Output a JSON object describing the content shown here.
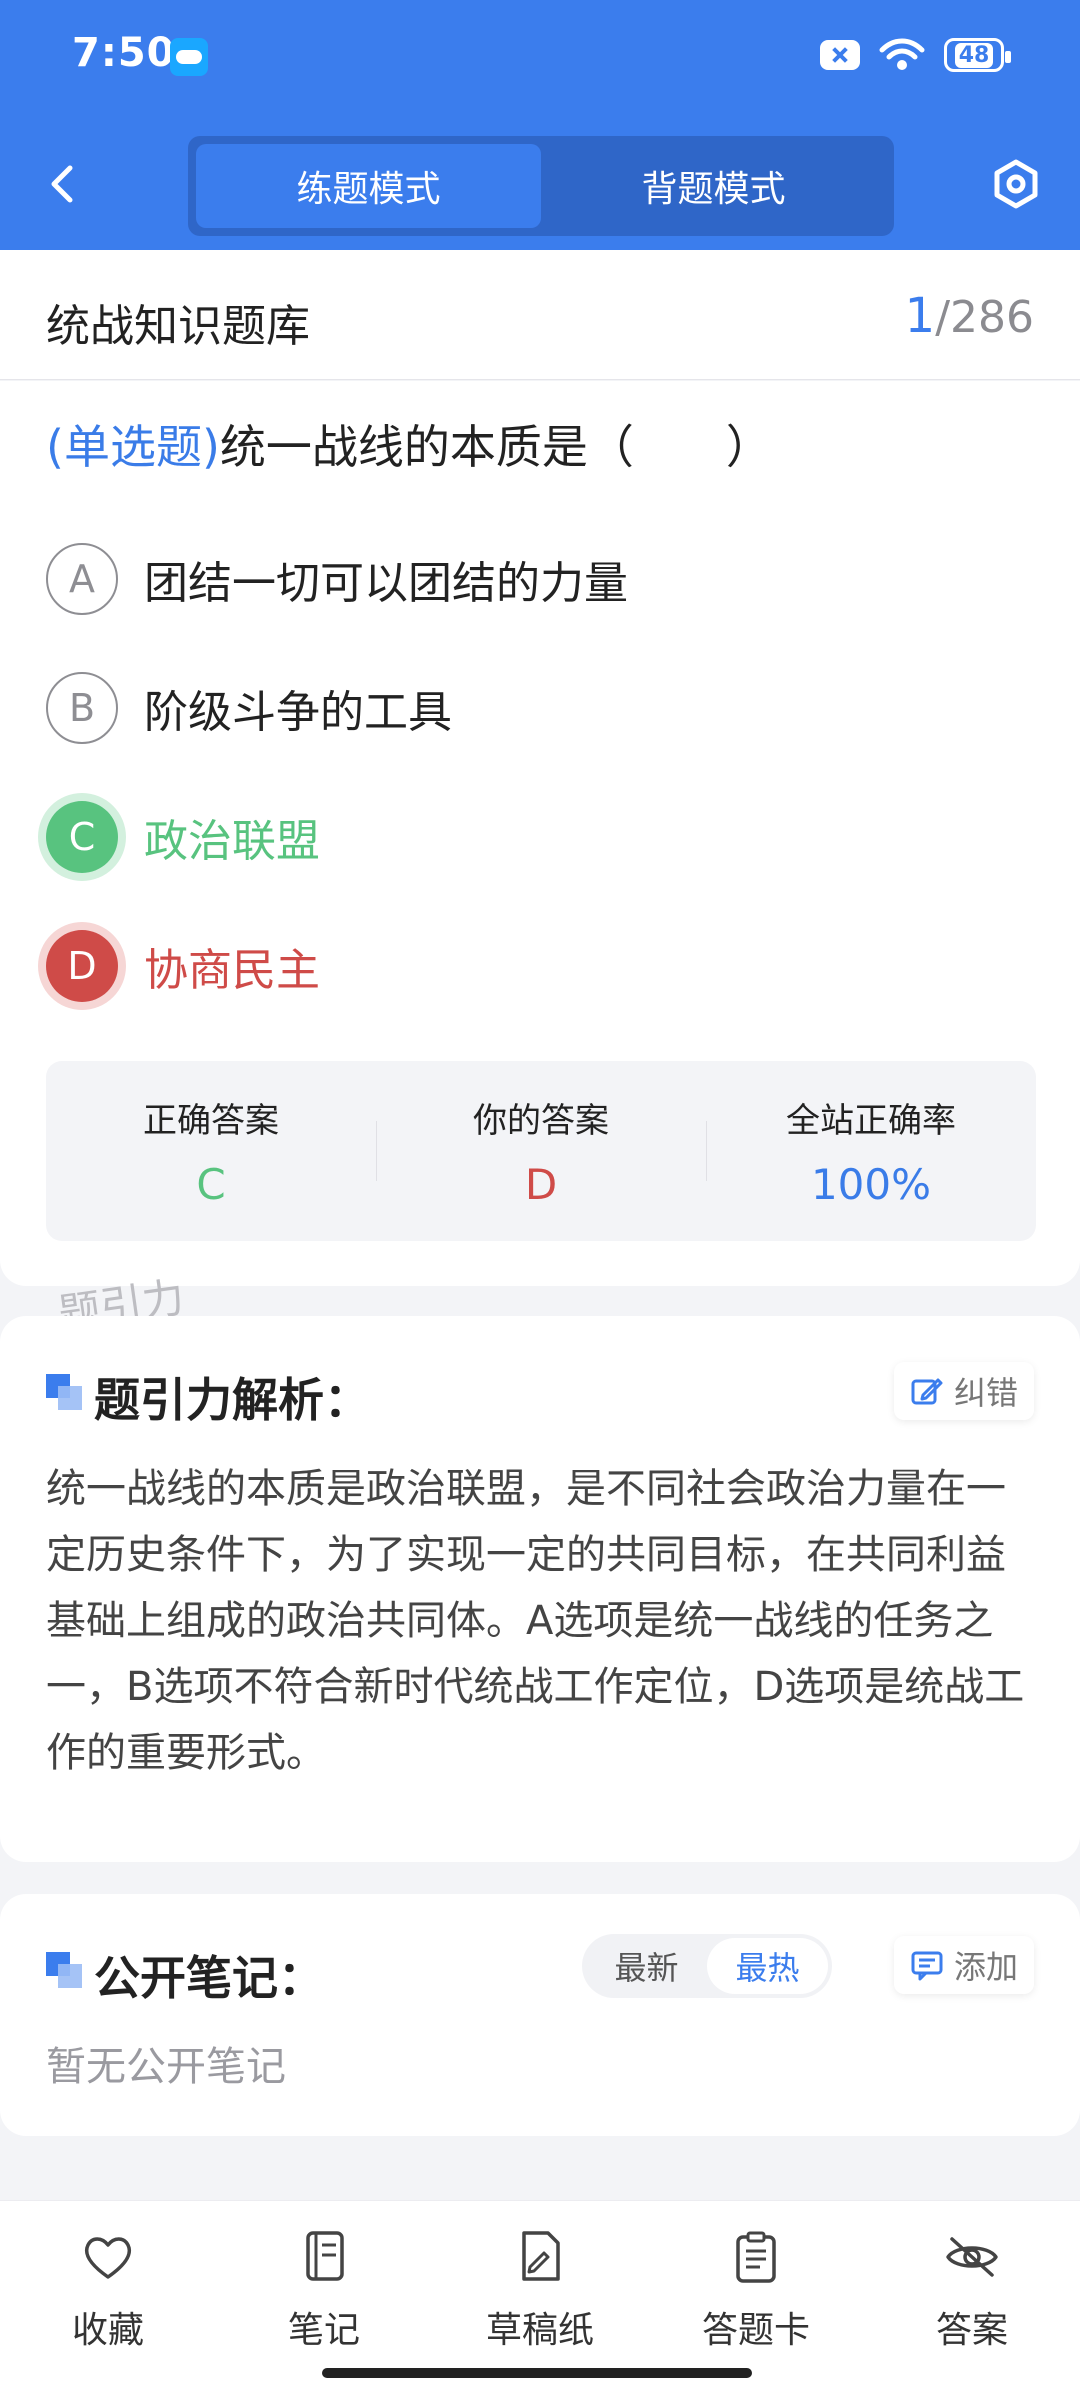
{
  "status_bar": {
    "time": "7:50",
    "battery": "48"
  },
  "top_tabs": {
    "practice_mode": "练题模式",
    "review_mode": "背题模式"
  },
  "header": {
    "bank_title": "统战知识题库",
    "current": "1",
    "total": "/286"
  },
  "question": {
    "type": "(单选题)",
    "text": "统一战线的本质是（　　）",
    "options": [
      {
        "key": "A",
        "text": "团结一切可以团结的力量"
      },
      {
        "key": "B",
        "text": "阶级斗争的工具"
      },
      {
        "key": "C",
        "text": "政治联盟"
      },
      {
        "key": "D",
        "text": "协商民主"
      }
    ]
  },
  "stats": {
    "correct_label": "正确答案",
    "correct_value": "C",
    "your_label": "你的答案",
    "your_value": "D",
    "rate_label": "全站正确率",
    "rate_value": "100%"
  },
  "watermark": "题引力",
  "analysis": {
    "title": "题引力解析：",
    "feedback_label": "纠错",
    "text": "统一战线的本质是政治联盟，是不同社会政治力量在一定历史条件下，为了实现一定的共同目标，在共同利益基础上组成的政治共同体。A选项是统一战线的任务之一，B选项不符合新时代统战工作定位，D选项是统战工作的重要形式。"
  },
  "notes": {
    "title": "公开笔记：",
    "sort_latest": "最新",
    "sort_hot": "最热",
    "add_label": "添加",
    "empty_text": "暂无公开笔记"
  },
  "bottom_tabs": {
    "favorite": "收藏",
    "notes": "笔记",
    "draft": "草稿纸",
    "answer_card": "答题卡",
    "answer": "答案"
  },
  "colors": {
    "brand": "#3b7ded",
    "correct": "#58c37f",
    "wrong": "#cf4b48"
  }
}
